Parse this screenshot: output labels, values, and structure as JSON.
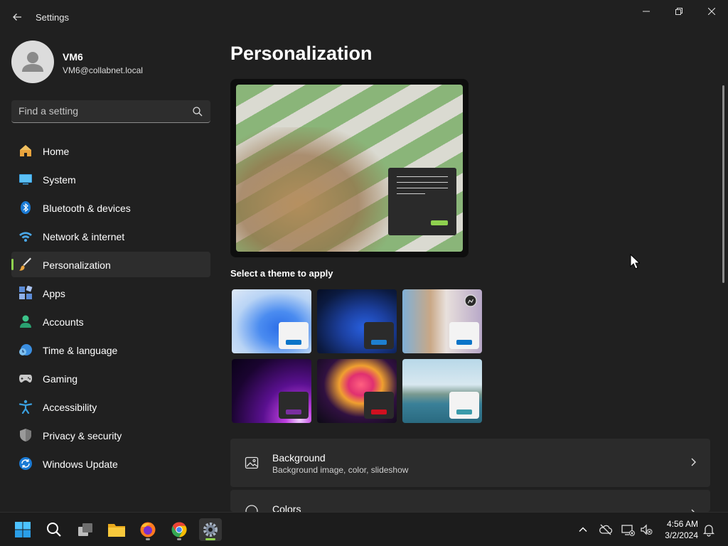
{
  "window": {
    "title": "Settings"
  },
  "user": {
    "name": "VM6",
    "email": "VM6@collabnet.local"
  },
  "search": {
    "placeholder": "Find a setting"
  },
  "nav": {
    "items": [
      {
        "label": "Home",
        "icon": "home-icon"
      },
      {
        "label": "System",
        "icon": "system-icon"
      },
      {
        "label": "Bluetooth & devices",
        "icon": "bluetooth-icon"
      },
      {
        "label": "Network & internet",
        "icon": "wifi-icon"
      },
      {
        "label": "Personalization",
        "icon": "brush-icon",
        "active": true
      },
      {
        "label": "Apps",
        "icon": "apps-icon"
      },
      {
        "label": "Accounts",
        "icon": "accounts-icon"
      },
      {
        "label": "Time & language",
        "icon": "clock-globe-icon"
      },
      {
        "label": "Gaming",
        "icon": "gamepad-icon"
      },
      {
        "label": "Accessibility",
        "icon": "accessibility-icon"
      },
      {
        "label": "Privacy & security",
        "icon": "shield-icon"
      },
      {
        "label": "Windows Update",
        "icon": "update-icon"
      }
    ]
  },
  "main": {
    "title": "Personalization",
    "themes_label": "Select a theme to apply",
    "rows": [
      {
        "title": "Background",
        "subtitle": "Background image, color, slideshow",
        "icon": "background-image-icon"
      },
      {
        "title": "Colors",
        "subtitle": "",
        "icon": "palette-icon"
      }
    ]
  },
  "colors": {
    "accent": "#8fd14f",
    "background": "#202020",
    "card": "#2b2b2b"
  },
  "taskbar": {
    "time": "4:56 AM",
    "date": "3/2/2024"
  }
}
